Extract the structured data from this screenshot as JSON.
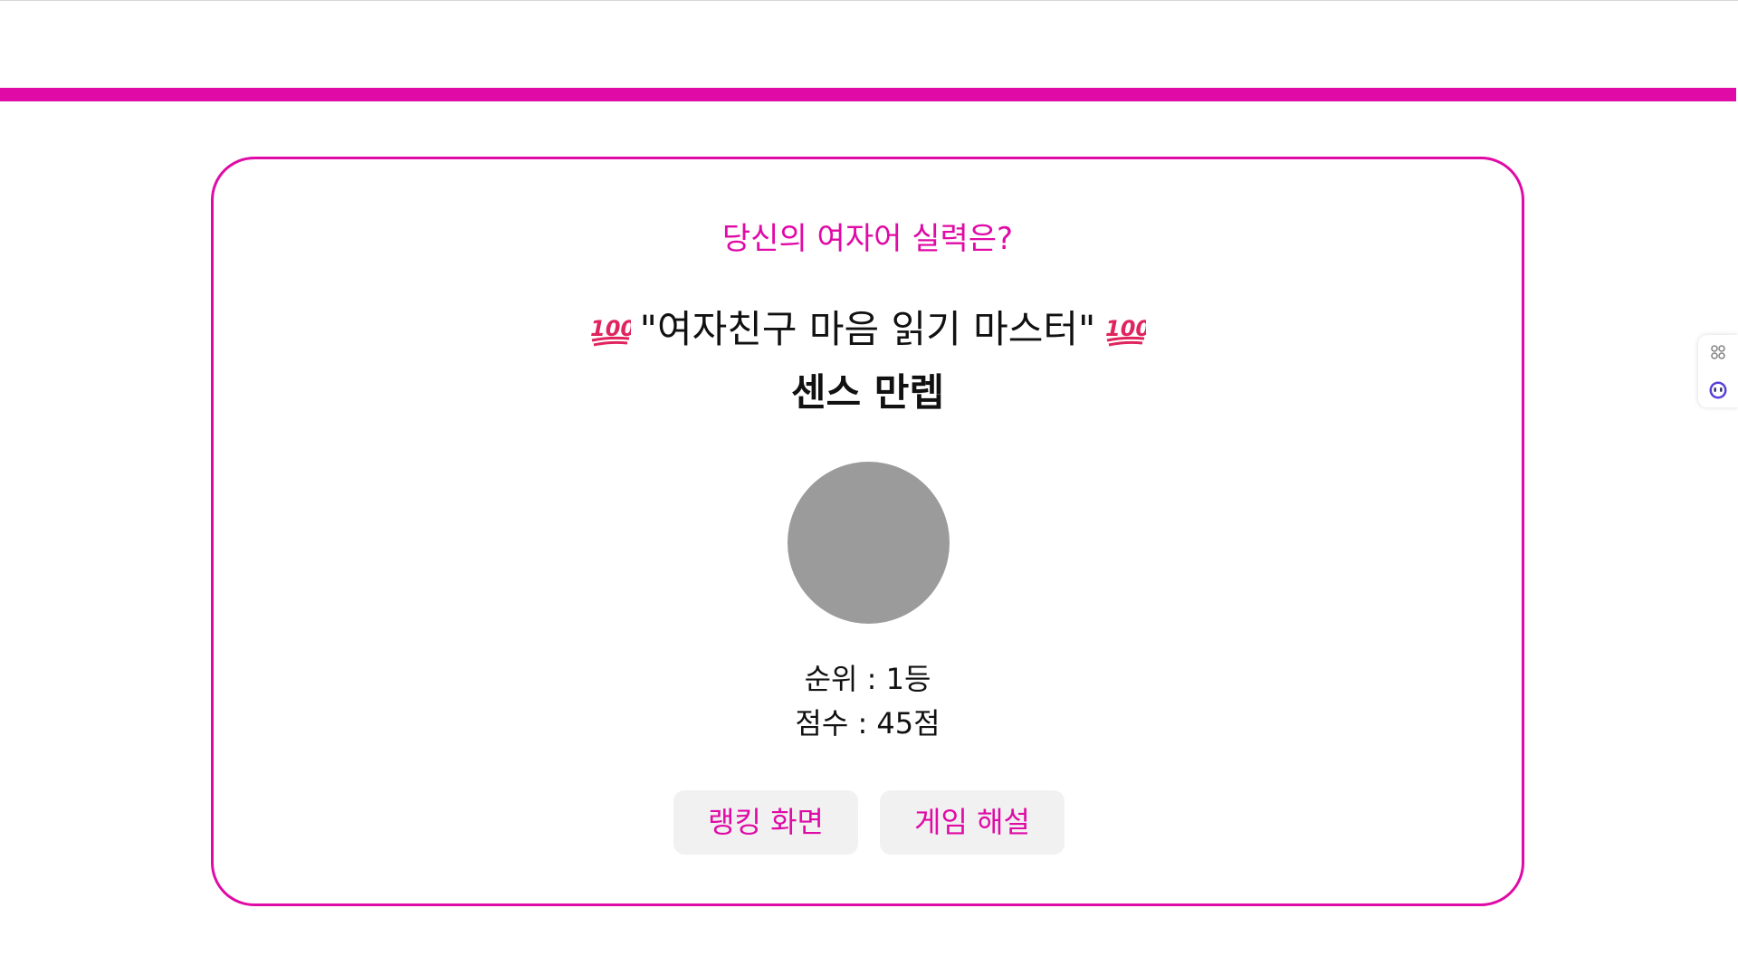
{
  "colors": {
    "accent": "#e00aa6",
    "avatar": "#9b9b9b",
    "button_bg": "#f1f1f1",
    "text": "#111111"
  },
  "result": {
    "question": "당신의 여자어 실력은?",
    "title_left_icon": "hundred-points-icon",
    "title": "\"여자친구 마음 읽기 마스터\"",
    "title_right_icon": "hundred-points-icon",
    "subtitle": "센스 만렙",
    "rank": "순위 : 1등",
    "score": "점수 : 45점"
  },
  "buttons": {
    "ranking": "랭킹 화면",
    "explanation": "게임 해설"
  },
  "side_widget": {
    "icons": [
      "grid-command-icon",
      "assistant-bot-icon"
    ]
  }
}
